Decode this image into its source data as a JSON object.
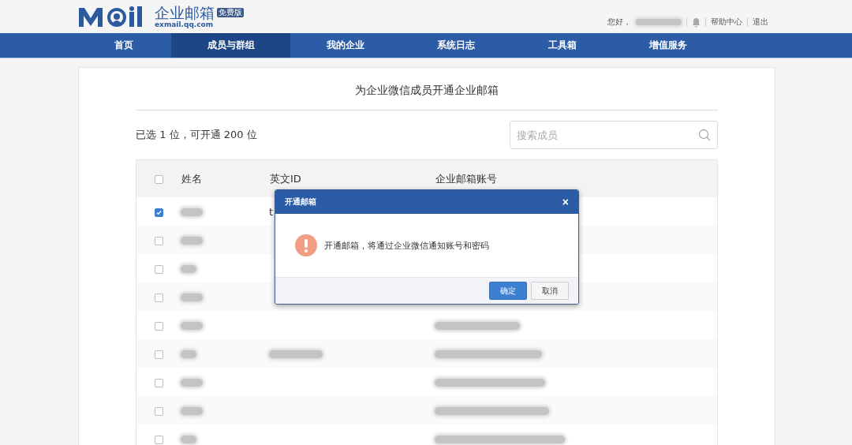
{
  "header": {
    "logo_text": "企业邮箱",
    "logo_badge": "免费版",
    "logo_domain": "exmail.qq.com",
    "greeting": "您好，",
    "user_name_blurred": true,
    "links": [
      "帮助中心",
      "退出"
    ]
  },
  "nav": [
    {
      "label": "首页",
      "selected": false
    },
    {
      "label": "成员与群组",
      "selected": true
    },
    {
      "label": "我的企业",
      "selected": false
    },
    {
      "label": "系统日志",
      "selected": false
    },
    {
      "label": "工具箱",
      "selected": false
    },
    {
      "label": "增值服务",
      "selected": false
    }
  ],
  "page_title": "为企业微信成员开通企业邮箱",
  "summary": "已选 1 位，可开通 200 位",
  "search": {
    "placeholder": "搜索成员"
  },
  "table": {
    "select_all_checked": false,
    "columns": [
      "姓名",
      "英文ID",
      "企业邮箱账号"
    ],
    "rows": [
      {
        "checked": true,
        "name_blurred": true,
        "english_id": "t"
      },
      {
        "checked": false,
        "name_blurred": true
      },
      {
        "checked": false,
        "name_blurred": true
      },
      {
        "checked": false,
        "name_blurred": true
      },
      {
        "checked": false,
        "name_blurred": true,
        "email_blurred": true
      },
      {
        "checked": false,
        "name_blurred": true,
        "english_id_blurred": true,
        "email_blurred": true
      },
      {
        "checked": false,
        "name_blurred": true,
        "email_blurred": true
      },
      {
        "checked": false,
        "name_blurred": true,
        "email_blurred": true
      },
      {
        "checked": false,
        "name_blurred": true,
        "email_blurred": true
      }
    ]
  },
  "dialog": {
    "title": "开通邮箱",
    "close": "×",
    "message": "开通邮箱，将通过企业微信通知账号和密码",
    "buttons": [
      {
        "label": "确定",
        "kind": "primary"
      },
      {
        "label": "取消",
        "kind": "secondary"
      }
    ]
  }
}
